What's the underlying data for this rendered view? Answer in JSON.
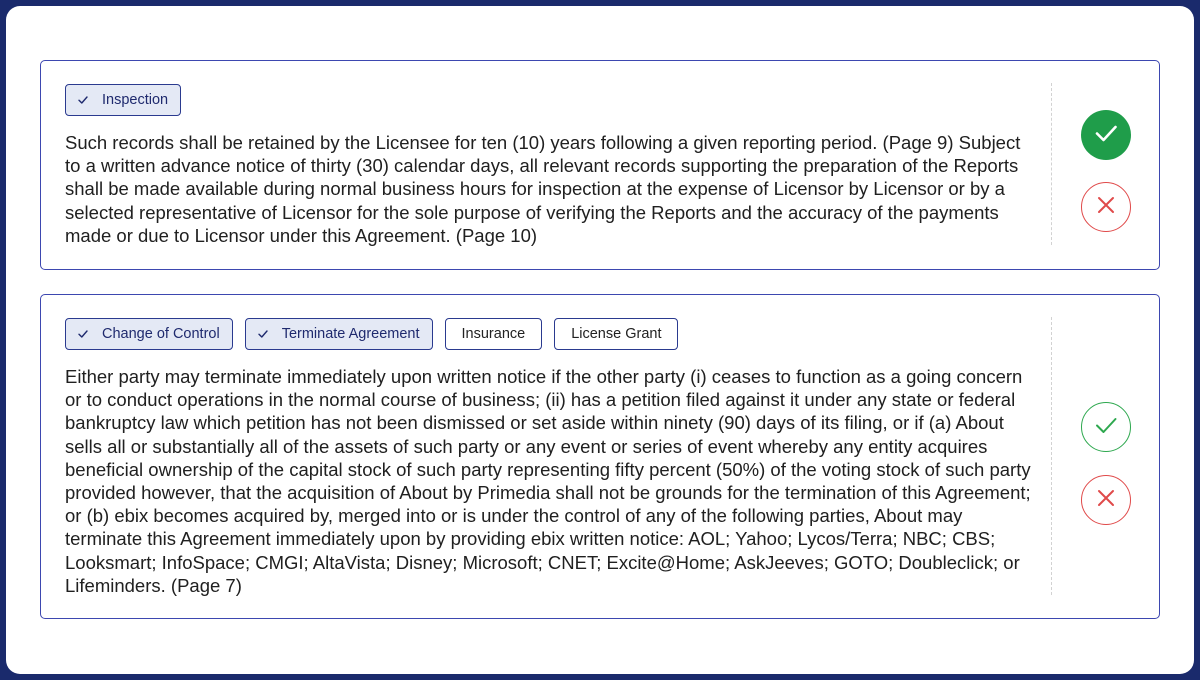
{
  "colors": {
    "outer_frame": "#1a2a6c",
    "card_border": "#3d47b0",
    "tag_selected_bg": "#e4e9f5",
    "accept_green": "#1f9d4a",
    "reject_red": "#e04a4a"
  },
  "cards": [
    {
      "tags": [
        {
          "label": "Inspection",
          "selected": true
        }
      ],
      "text": "Such records shall be retained by the Licensee for ten (10) years following a given reporting period. (Page 9) Subject to a written advance notice of thirty (30) calendar days, all relevant records supporting the preparation of the Reports shall be made available during normal business hours for inspection at the expense of Licensor by Licensor or by a selected representative of Licensor for the sole purpose of verifying the Reports and the accuracy of the payments made or due to Licensor under this Agreement. (Page 10)",
      "accept_icon": "check-icon",
      "reject_icon": "close-icon",
      "accepted": true
    },
    {
      "tags": [
        {
          "label": "Change of Control",
          "selected": true
        },
        {
          "label": "Terminate Agreement",
          "selected": true
        },
        {
          "label": "Insurance",
          "selected": false
        },
        {
          "label": "License Grant",
          "selected": false
        }
      ],
      "text": "Either party may terminate immediately upon written notice if the other party (i) ceases to function as a going concern or to conduct operations in the normal course of business; (ii) has a petition filed against it under any state or federal bankruptcy law which petition has not been dismissed or set aside within ninety (90) days of its filing, or if (a) About sells all or substantially all of the assets of such party or any event or series of event whereby any entity acquires beneficial ownership of the capital stock of such party representing fifty percent (50%) of the voting stock of such party provided however, that the acquisition of About by Primedia shall not be grounds for the termination of this Agreement; or (b) ebix becomes acquired by, merged into or is under the control of any of the following parties, About may terminate this Agreement immediately upon by providing ebix written notice: AOL; Yahoo; Lycos/Terra; NBC; CBS; Looksmart; InfoSpace; CMGI; AltaVista; Disney; Microsoft; CNET; Excite@Home; AskJeeves; GOTO; Doubleclick; or Lifeminders. (Page 7)",
      "accept_icon": "check-icon",
      "reject_icon": "close-icon",
      "accepted": false
    }
  ]
}
